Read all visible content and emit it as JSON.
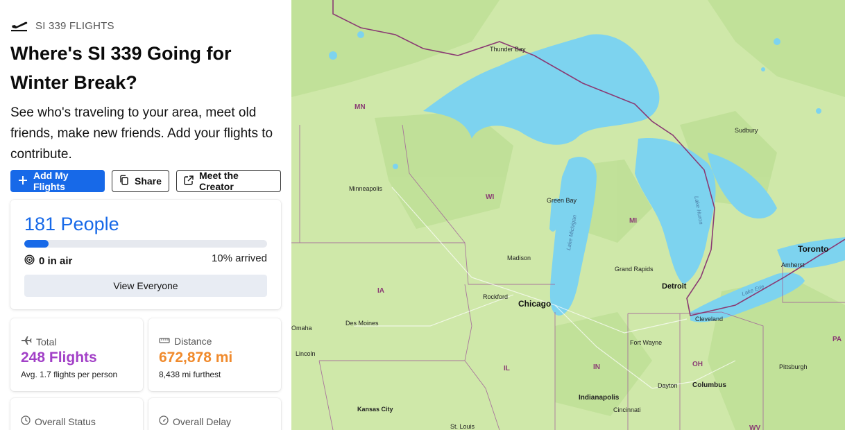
{
  "header": {
    "brand": "SI 339 FLIGHTS",
    "brand_icon": "airplane-takeoff-icon"
  },
  "page": {
    "title": "Where's SI 339 Going for Winter Break?",
    "subtitle": "See who's traveling to your area, meet old friends, make new friends. Add your flights to contribute."
  },
  "actions": {
    "add": "Add My Flights",
    "share": "Share",
    "creator": "Meet the Creator"
  },
  "people": {
    "count": "181 People",
    "in_air": "0 in air",
    "arrived": "10% arrived",
    "arrived_fraction": 0.1,
    "view_all": "View Everyone"
  },
  "stats": {
    "total": {
      "label": "Total",
      "value": "248 Flights",
      "sub": "Avg. 1.7 flights per person",
      "color": "#a240c7"
    },
    "distance": {
      "label": "Distance",
      "value": "672,878 mi",
      "sub": "8,438 mi furthest",
      "color": "#f08a2c"
    },
    "status": {
      "label": "Overall Status"
    },
    "delay": {
      "label": "Overall Delay"
    }
  },
  "colors": {
    "accent": "#1769e8",
    "water": "#7dd3ef",
    "land": "#cfe8a9",
    "border": "#8a3a73"
  },
  "map": {
    "cities": [
      "Thunder Bay",
      "Sudbury",
      "Minneapolis",
      "Green Bay",
      "Madison",
      "Grand Rapids",
      "Toronto",
      "Amherst",
      "Rockford",
      "Chicago",
      "Detroit",
      "Des Moines",
      "Cleveland",
      "Omaha",
      "Lincoln",
      "Fort Wayne",
      "Pittsburgh",
      "Dayton",
      "Columbus",
      "Indianapolis",
      "Kansas City",
      "Cincinnati",
      "St. Louis"
    ],
    "states": [
      "MN",
      "WI",
      "MI",
      "IA",
      "IL",
      "IN",
      "OH",
      "PA",
      "WV"
    ],
    "lakes": [
      "Lake Michigan",
      "Lake Huron",
      "Lake Erie"
    ]
  }
}
